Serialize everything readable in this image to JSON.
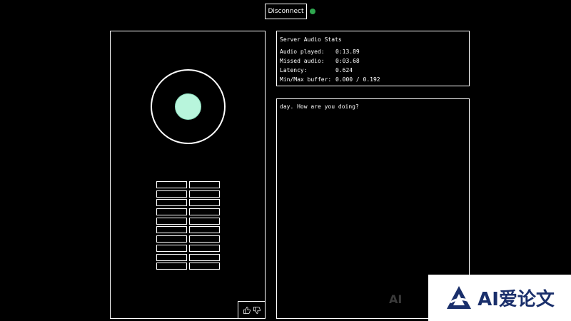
{
  "header": {
    "disconnect_label": "Disconnect",
    "status_color": "#2fa84f"
  },
  "visualizer": {
    "core_color": "#b8f5dc",
    "meter_rows": 10,
    "meter_cols": 2
  },
  "feedback": {
    "thumbs_up_icon": "thumbs-up-icon",
    "thumbs_down_icon": "thumbs-down-icon"
  },
  "stats": {
    "title": "Server Audio Stats",
    "rows": [
      {
        "label": "Audio played:",
        "value": "0:13.89"
      },
      {
        "label": "Missed audio:",
        "value": "0:03.68"
      },
      {
        "label": "Latency:",
        "value": "0.624"
      },
      {
        "label": "Min/Max buffer:",
        "value": "0.000 / 0.192"
      }
    ]
  },
  "transcript": {
    "text": "day. How are you doing?"
  },
  "watermark": {
    "text": "AI爱论文",
    "faint_text": "AI"
  }
}
